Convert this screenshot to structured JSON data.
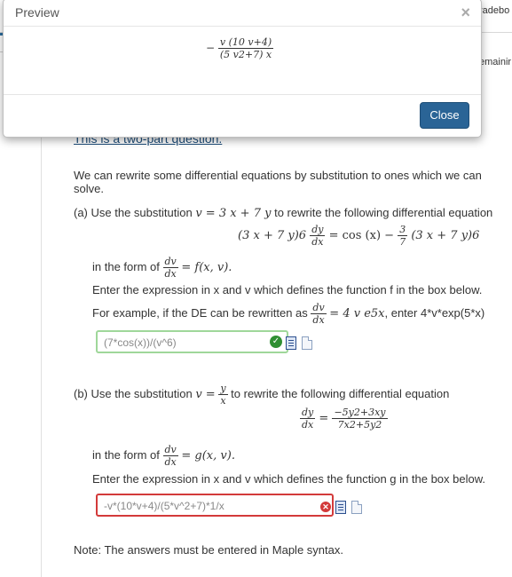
{
  "background": {
    "gradebook_label": "radebo",
    "remaining_label": "emainir"
  },
  "question": {
    "header": "This is a two-part question.",
    "intro": "We can rewrite some differential equations by substitution to ones which we can solve.",
    "part_a": {
      "lead": "(a) Use the substitution",
      "substitution": "v = 3 x + 7 y",
      "lead_tail": "to rewrite the following differential equation",
      "equation_lhs": "(3 x + 7 y)6",
      "equation_frac_num": "dy",
      "equation_frac_den": "dx",
      "equation_rhs": "= cos (x) −",
      "equation_rhs_frac_num": "3",
      "equation_rhs_frac_den": "7",
      "equation_rhs_tail": "(3 x + 7 y)6",
      "form_lead": "in the form of",
      "form_frac_num": "dv",
      "form_frac_den": "dx",
      "form_tail": "= f(x, v).",
      "instruction": "Enter the expression in x and v which defines the function  f in the box below.",
      "example_lead": "For example, if the DE can be rewritten as",
      "example_frac_num": "dv",
      "example_frac_den": "dx",
      "example_mid": "= 4 v e5x",
      "example_tail": ", enter 4*v*exp(5*x)",
      "answer_value": "(7*cos(x))/(v^6)"
    },
    "part_b": {
      "lead": "(b) Use the substitution",
      "substitution": "v =",
      "sub_frac_num": "y",
      "sub_frac_den": "x",
      "lead_tail": "to rewrite the following differential equation",
      "eq_lhs_num": "dy",
      "eq_lhs_den": "dx",
      "eq_rhs_num": "−5y2+3xy",
      "eq_rhs_den": "7x2+5y2",
      "form_lead": "in the form of",
      "form_frac_num": "dv",
      "form_frac_den": "dx",
      "form_tail": "= g(x, v).",
      "instruction": "Enter the expression in x and v which defines the function g in the box below.",
      "answer_value": "-v*(10*v+4)/(5*v^2+7)*1/x"
    },
    "note": "Note: The answers must be entered in Maple syntax."
  },
  "modal": {
    "title": "Preview",
    "close_x": "×",
    "expr_minus": "−",
    "expr_num": "v (10 v+4)",
    "expr_den": "(5 v2+7) x",
    "close_button": "Close"
  },
  "colors": {
    "accent": "#2a6496",
    "ok": "#2f8f33",
    "error": "#d33a3a"
  }
}
